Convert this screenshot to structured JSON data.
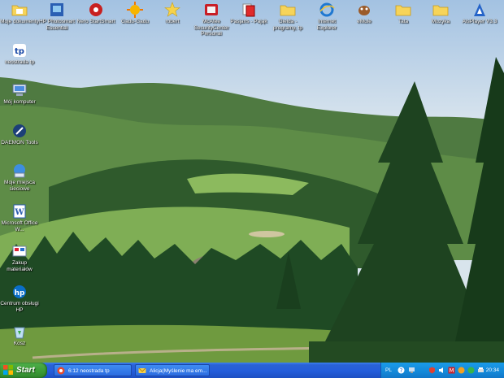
{
  "desktop": {
    "top_icons": [
      {
        "label": "Moje dokumenty",
        "icon": "folder-documents-icon"
      },
      {
        "label": "HP Photosmart Essential",
        "icon": "hp-photosmart-icon"
      },
      {
        "label": "Nero StartSmart",
        "icon": "nero-icon"
      },
      {
        "label": "Gadu-Gadu",
        "icon": "gadu-gadu-icon"
      },
      {
        "label": "robert",
        "icon": "star-folder-icon"
      },
      {
        "label": "McAfee SecurityCenter Personal",
        "icon": "mcafee-icon"
      },
      {
        "label": "Pasjans - Pająk",
        "icon": "solitaire-icon"
      },
      {
        "label": "Gielda - programy, tp",
        "icon": "folder-icon"
      },
      {
        "label": "Internet Explorer",
        "icon": "internet-explorer-icon"
      },
      {
        "label": "eMule",
        "icon": "emule-icon"
      },
      {
        "label": "Tata",
        "icon": "folder-icon"
      },
      {
        "label": "Muzyka",
        "icon": "folder-icon"
      },
      {
        "label": "AlsPlayer V3.3",
        "icon": "player-icon"
      }
    ],
    "left_icons": [
      {
        "label": "neostrada tp",
        "icon": "neostrada-icon"
      },
      {
        "label": "Mój komputer",
        "icon": "my-computer-icon"
      },
      {
        "label": "DAEMON Tools",
        "icon": "daemon-tools-icon"
      },
      {
        "label": "Moje miejsca sieciowe",
        "icon": "network-places-icon"
      },
      {
        "label": "Microsoft Office W...",
        "icon": "office-word-icon"
      },
      {
        "label": "Zakup materiałów",
        "icon": "purchase-icon"
      },
      {
        "label": "Centrum obsługi HP",
        "icon": "hp-center-icon"
      },
      {
        "label": "Kosz",
        "icon": "recycle-bin-icon"
      }
    ]
  },
  "taskbar": {
    "start_label": "Start",
    "tasks": [
      {
        "label": "6:12 neostrada tp",
        "icon": "neostrada-task-icon"
      },
      {
        "label": "Alicja(Myślenie ma em...",
        "icon": "messenger-task-icon"
      }
    ],
    "tray": {
      "language": "PL",
      "time": "20:34",
      "icons": [
        "help-tray-icon",
        "network-tray-icon",
        "security-tray-icon",
        "volume-tray-icon",
        "antivirus-tray-icon",
        "messenger-tray-icon",
        "update-tray-icon",
        "printer-tray-icon"
      ]
    }
  }
}
